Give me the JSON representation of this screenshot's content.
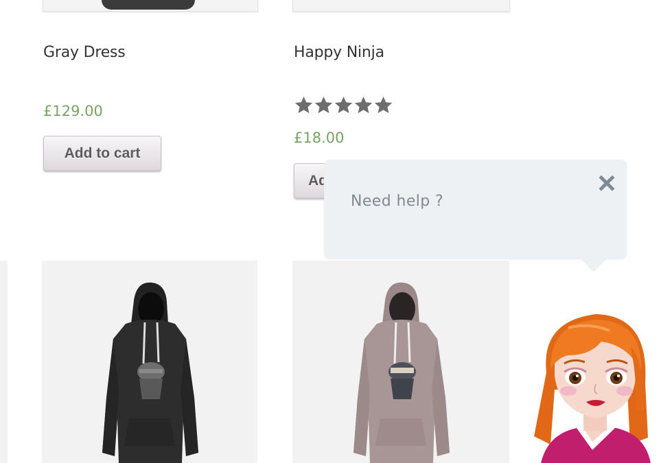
{
  "colors": {
    "price": "#77a464",
    "title": "#333333",
    "star": "#6d6d6d",
    "bubble": "#eef1f3",
    "help_text": "#7f8a93",
    "close": "#7d8b96",
    "avatar_hair": "#e9711d"
  },
  "products": [
    {
      "title": "Gray Dress",
      "price": "£129.00",
      "button": "Add to cart"
    },
    {
      "title": "Happy Ninja",
      "rating_stars": 5,
      "rating_max": 5,
      "price": "£18.00",
      "button": "Add to cart"
    },
    {
      "image": "black-ninja-hoodie"
    },
    {
      "image": "pink-ninja-hoodie"
    }
  ],
  "chat": {
    "message": "Need help ?",
    "close_icon": "close-icon",
    "avatar": "support-avatar"
  }
}
